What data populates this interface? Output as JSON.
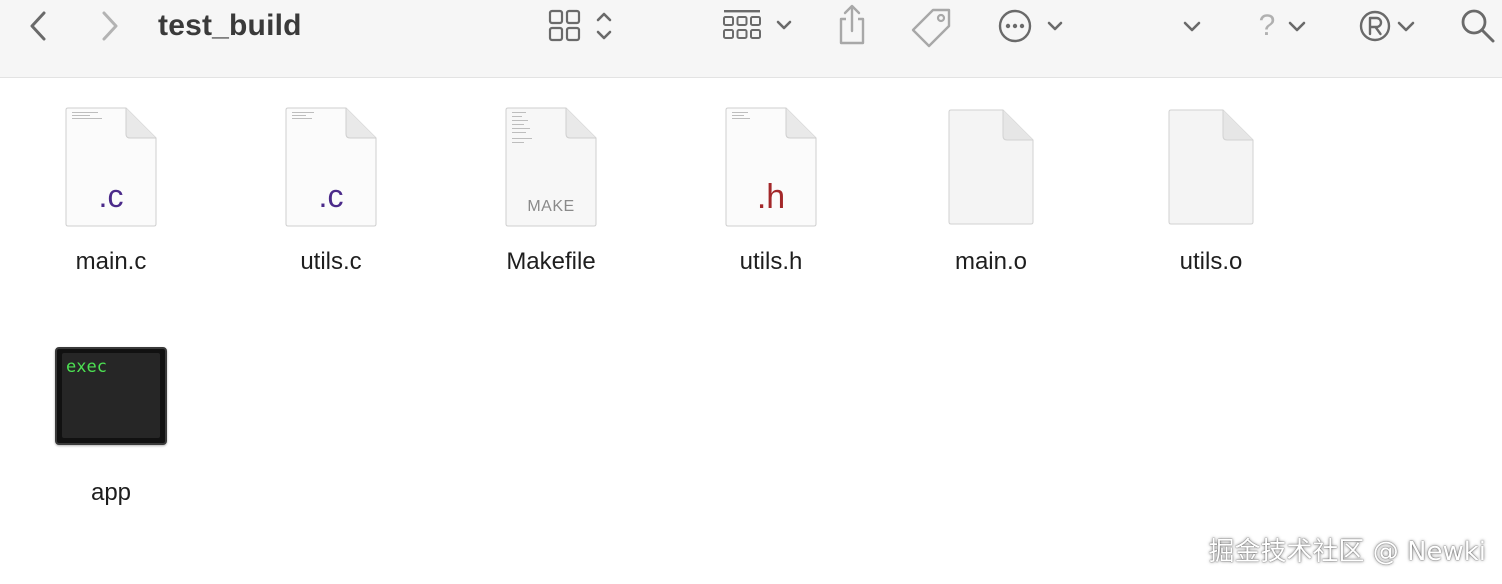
{
  "window": {
    "title": "test_build"
  },
  "toolbar": {
    "back_icon": "chevron-left-icon",
    "forward_icon": "chevron-right-icon",
    "view_icon": "grid-view-icon",
    "group_icon": "group-by-icon",
    "share_icon": "share-icon",
    "tag_icon": "tag-icon",
    "action_icon": "more-actions-icon",
    "help_label": "?",
    "search_icon": "search-icon"
  },
  "files": [
    {
      "name": "main.c",
      "kind": "c",
      "ext_label": ".c"
    },
    {
      "name": "utils.c",
      "kind": "c",
      "ext_label": ".c"
    },
    {
      "name": "Makefile",
      "kind": "make",
      "ext_label": "MAKE"
    },
    {
      "name": "utils.h",
      "kind": "h",
      "ext_label": ".h"
    },
    {
      "name": "main.o",
      "kind": "blank",
      "ext_label": ""
    },
    {
      "name": "utils.o",
      "kind": "blank",
      "ext_label": ""
    },
    {
      "name": "app",
      "kind": "exec",
      "ext_label": "exec"
    }
  ],
  "colors": {
    "c_ext": "#4b2a8a",
    "h_ext": "#a3282a",
    "exec_text": "#4ce152",
    "toolbar_bg": "#f6f6f6"
  },
  "watermark": "掘金技术社区 @ Newki"
}
